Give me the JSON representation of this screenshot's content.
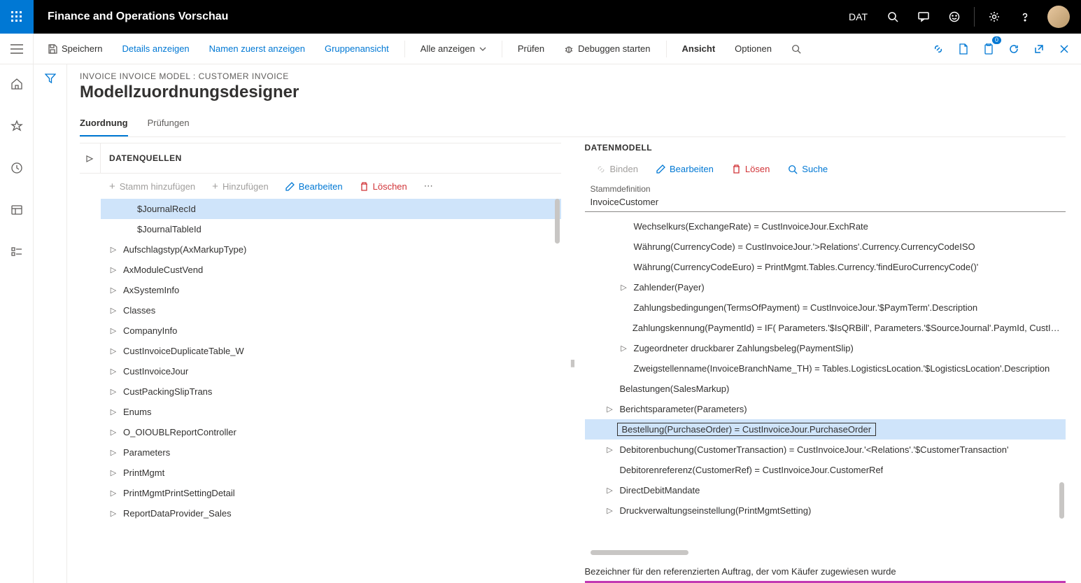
{
  "topbar": {
    "title": "Finance and Operations Vorschau",
    "company": "DAT"
  },
  "cmdbar": {
    "save": "Speichern",
    "details": "Details anzeigen",
    "names_first": "Namen zuerst anzeigen",
    "group_view": "Gruppenansicht",
    "show_all": "Alle anzeigen",
    "check": "Prüfen",
    "debug": "Debuggen starten",
    "view": "Ansicht",
    "options": "Optionen",
    "badge_count": "0"
  },
  "page": {
    "breadcrumb": "INVOICE INVOICE MODEL : CUSTOMER INVOICE",
    "title": "Modellzuordnungsdesigner",
    "tabs": {
      "mapping": "Zuordnung",
      "checks": "Prüfungen"
    }
  },
  "ds": {
    "header": "DATENQUELLEN",
    "toolbar": {
      "add_root": "Stamm hinzufügen",
      "add": "Hinzufügen",
      "edit": "Bearbeiten",
      "delete": "Löschen"
    },
    "items": [
      {
        "label": "$JournalRecId",
        "leaf": true,
        "selected": true
      },
      {
        "label": "$JournalTableId",
        "leaf": true
      },
      {
        "label": "Aufschlagstyp(AxMarkupType)"
      },
      {
        "label": "AxModuleCustVend"
      },
      {
        "label": "AxSystemInfo"
      },
      {
        "label": "Classes"
      },
      {
        "label": "CompanyInfo"
      },
      {
        "label": "CustInvoiceDuplicateTable_W"
      },
      {
        "label": "CustInvoiceJour"
      },
      {
        "label": "CustPackingSlipTrans"
      },
      {
        "label": "Enums"
      },
      {
        "label": "O_OIOUBLReportController"
      },
      {
        "label": "Parameters"
      },
      {
        "label": "PrintMgmt"
      },
      {
        "label": "PrintMgmtPrintSettingDetail"
      },
      {
        "label": "ReportDataProvider_Sales"
      }
    ]
  },
  "dm": {
    "header": "DATENMODELL",
    "toolbar": {
      "bind": "Binden",
      "edit": "Bearbeiten",
      "delete": "Lösen",
      "search": "Suche"
    },
    "root_label": "Stammdefinition",
    "root_value": "InvoiceCustomer",
    "items": [
      {
        "label": "Wechselkurs(ExchangeRate) = CustInvoiceJour.ExchRate",
        "indent": 1,
        "leaf": true
      },
      {
        "label": "Währung(CurrencyCode) = CustInvoiceJour.'>Relations'.Currency.CurrencyCodeISO",
        "indent": 1,
        "leaf": true
      },
      {
        "label": "Währung(CurrencyCodeEuro) = PrintMgmt.Tables.Currency.'findEuroCurrencyCode()'",
        "indent": 1,
        "leaf": true
      },
      {
        "label": "Zahlender(Payer)",
        "indent": 1
      },
      {
        "label": "Zahlungsbedingungen(TermsOfPayment) = CustInvoiceJour.'$PaymTerm'.Description",
        "indent": 1,
        "leaf": true
      },
      {
        "label": "Zahlungskennung(PaymentId) = IF( Parameters.'$IsQRBill', Parameters.'$SourceJournal'.PaymId, CustInvoiceJour.",
        "indent": 1,
        "leaf": true
      },
      {
        "label": "Zugeordneter druckbarer Zahlungsbeleg(PaymentSlip)",
        "indent": 1
      },
      {
        "label": "Zweigstellenname(InvoiceBranchName_TH) = Tables.LogisticsLocation.'$LogisticsLocation'.Description",
        "indent": 1,
        "leaf": true
      },
      {
        "label": "Belastungen(SalesMarkup)",
        "indent": 0,
        "leaf": true
      },
      {
        "label": "Berichtsparameter(Parameters)",
        "indent": 0
      },
      {
        "label": "Bestellung(PurchaseOrder) = CustInvoiceJour.PurchaseOrder",
        "indent": 0,
        "leaf": true,
        "selected": true
      },
      {
        "label": "Debitorenbuchung(CustomerTransaction) = CustInvoiceJour.'<Relations'.'$CustomerTransaction'",
        "indent": 0
      },
      {
        "label": "Debitorenreferenz(CustomerRef) = CustInvoiceJour.CustomerRef",
        "indent": 0,
        "leaf": true
      },
      {
        "label": "DirectDebitMandate",
        "indent": 0
      },
      {
        "label": "Druckverwaltungseinstellung(PrintMgmtSetting)",
        "indent": 0
      }
    ],
    "selected_desc": "Bezeichner für den referenzierten Auftrag, der vom Käufer zugewiesen wurde"
  }
}
